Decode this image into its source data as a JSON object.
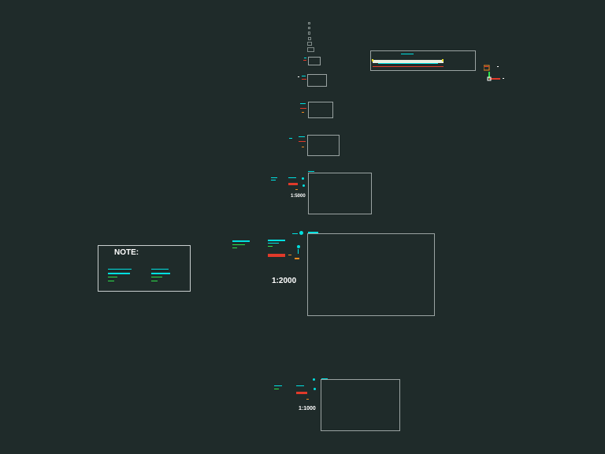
{
  "note": {
    "title": "NOTE:"
  },
  "scales": {
    "large": "1:2000",
    "medium": "1:5000",
    "bottom": "1:1000"
  },
  "colors": {
    "background": "#1f2b2a",
    "frame": "#9aa3a2",
    "cyan": "#00e0e0",
    "green": "#2ee04a",
    "red": "#e03a2a",
    "orange": "#f08a20"
  },
  "icons": [
    "axis-icon"
  ]
}
